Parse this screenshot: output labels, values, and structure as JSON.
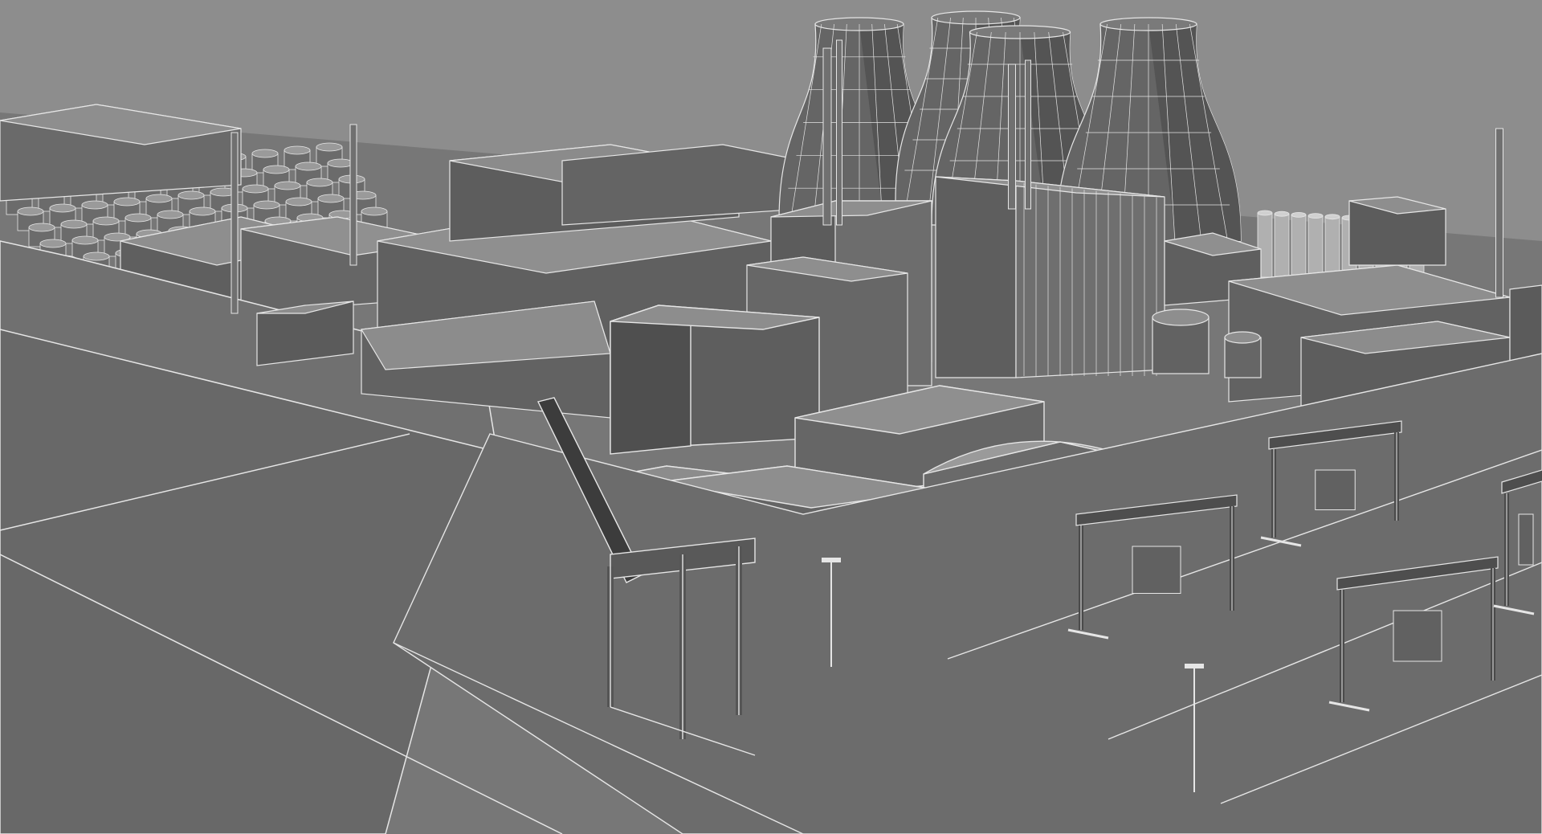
{
  "scene": {
    "kind": "wireframe-3d-render",
    "subject": "industrial-port-power-plant",
    "colors": {
      "sky": "#8d8d8d",
      "ground": "#6f6f6f",
      "ground_far": "#7a7a7a",
      "face_top": "#8e8e8e",
      "face_light": "#7c7c7c",
      "face_dark": "#5a5a5a",
      "edge": "#e6e6e6",
      "shadow": "#3e3e3e"
    },
    "counts": {
      "cooling_towers": 4,
      "chimneys": 7,
      "gantry_cranes": 4,
      "storage_silos_right": 10
    }
  }
}
